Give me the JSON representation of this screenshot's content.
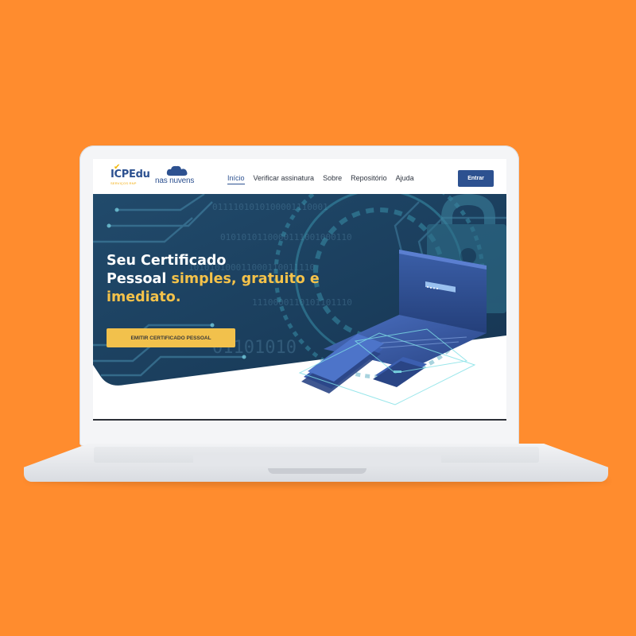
{
  "nav": {
    "logo_icp": "ICPEdu",
    "logo_icp_sub": "SERVIÇOS RNP",
    "logo_nuvens": "nas nuvens",
    "links": [
      "Início",
      "Verificar assinatura",
      "Sobre",
      "Repositório",
      "Ajuda"
    ],
    "active_link": "Início",
    "login_button": "Entrar"
  },
  "hero": {
    "title_line1": "Seu Certificado",
    "title_line2_plain": "Pessoal ",
    "title_line2_highlight": "simples, gratuito e",
    "title_line3_highlight": "imediato.",
    "cta": "EMITIR CERTIFICADO PESSOAL"
  },
  "colors": {
    "background": "#ff8c2e",
    "brand_blue": "#2d5190",
    "accent_yellow": "#f2c14c",
    "hero_dark": "#1d3f60"
  }
}
